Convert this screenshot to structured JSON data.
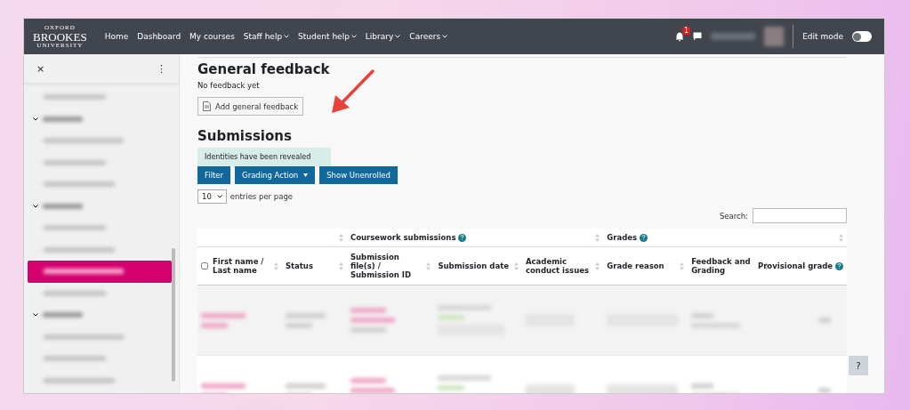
{
  "navbar": {
    "logo": [
      "OXFORD",
      "BROOKES",
      "UNIVERSITY"
    ],
    "menu": [
      {
        "label": "Home"
      },
      {
        "label": "Dashboard"
      },
      {
        "label": "My courses"
      },
      {
        "label": "Staff help",
        "dropdown": true
      },
      {
        "label": "Student help",
        "dropdown": true
      },
      {
        "label": "Library",
        "dropdown": true
      },
      {
        "label": "Careers",
        "dropdown": true
      }
    ],
    "notification_count": "1",
    "edit_mode": {
      "label": "Edit mode",
      "on": false
    }
  },
  "sidebar": {
    "close": "×",
    "more": "⋮",
    "items": [
      {
        "kind": "item",
        "selected": false
      },
      {
        "kind": "section",
        "selected": false
      },
      {
        "kind": "item",
        "selected": false
      },
      {
        "kind": "item",
        "selected": false
      },
      {
        "kind": "item",
        "selected": false
      },
      {
        "kind": "section",
        "selected": false
      },
      {
        "kind": "item",
        "selected": false
      },
      {
        "kind": "item",
        "selected": false
      },
      {
        "kind": "item",
        "selected": true
      },
      {
        "kind": "item",
        "selected": false
      },
      {
        "kind": "section",
        "selected": false
      },
      {
        "kind": "item",
        "selected": false
      },
      {
        "kind": "item",
        "selected": false
      },
      {
        "kind": "item",
        "selected": false
      }
    ]
  },
  "general_feedback": {
    "title": "General feedback",
    "text": "No feedback yet",
    "button": "Add general feedback"
  },
  "submissions": {
    "title": "Submissions",
    "notice": "Identities have been revealed",
    "buttons": [
      {
        "label": "Filter"
      },
      {
        "label": "Grading Action",
        "dropdown": true
      },
      {
        "label": "Show Unenrolled"
      }
    ],
    "page_size": "10",
    "page_size_label": "entries per page",
    "search_label": "Search:"
  },
  "table": {
    "select_all_checked": false,
    "groups": [
      {
        "sortable": true
      },
      {
        "label": "Coursework submissions",
        "help": true,
        "sortable": true
      },
      {
        "label": "Grades",
        "help": true,
        "sortable": true
      }
    ],
    "columns": [
      {
        "label": "First name / Last name"
      },
      {
        "label": "Status"
      },
      {
        "label": "Submission file(s) / Submission ID"
      },
      {
        "label": "Submission date"
      },
      {
        "label": "Academic conduct issues"
      },
      {
        "label": "Grade reason"
      },
      {
        "label": "Feedback and Grading"
      },
      {
        "label": "Provisional grade",
        "help": true
      }
    ],
    "rows": [
      {
        "shaded": true
      },
      {
        "shaded": false
      }
    ]
  },
  "help_button": "?"
}
